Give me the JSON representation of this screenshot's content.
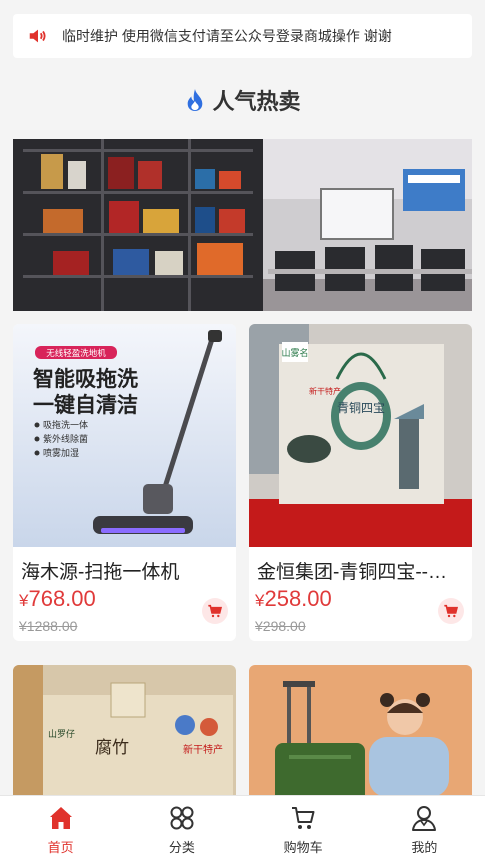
{
  "notice": {
    "icon": "speaker-icon",
    "text": "临时维护 使用微信支付请至公众号登录商城操作 谢谢"
  },
  "section": {
    "icon": "flame-icon",
    "title": "人气热卖"
  },
  "banner": {
    "icon": "showroom-photo"
  },
  "products": [
    {
      "name": "海木源-扫拖一体机",
      "currency": "¥",
      "price": "768.00",
      "old_price": "¥1288.00",
      "image_badge": "无线轻盈洗地机",
      "image_headline": "智能吸拖洗",
      "image_headline2": "一键自清洁",
      "image_features": [
        "吸拖洗一体",
        "紫外线除菌",
        "喷雾加湿"
      ]
    },
    {
      "name": "金恒集团-青铜四宝--…",
      "currency": "¥",
      "price": "258.00",
      "old_price": "¥298.00",
      "image_text": "青铜四宝",
      "image_side": "新干特产",
      "image_tag": "山雾名"
    },
    {
      "name": "",
      "image_text": "腐竹",
      "image_side": "新干特产",
      "image_tag": "山罗仔"
    },
    {
      "name": "",
      "image_text": ""
    }
  ],
  "tabbar": [
    {
      "label": "首页",
      "icon": "home-icon",
      "active": true
    },
    {
      "label": "分类",
      "icon": "category-icon",
      "active": false
    },
    {
      "label": "购物车",
      "icon": "cart-icon",
      "active": false
    },
    {
      "label": "我的",
      "icon": "user-icon",
      "active": false
    }
  ],
  "colors": {
    "accent": "#e0322c",
    "price": "#e03a3a",
    "flame": "#2f6fe0"
  }
}
